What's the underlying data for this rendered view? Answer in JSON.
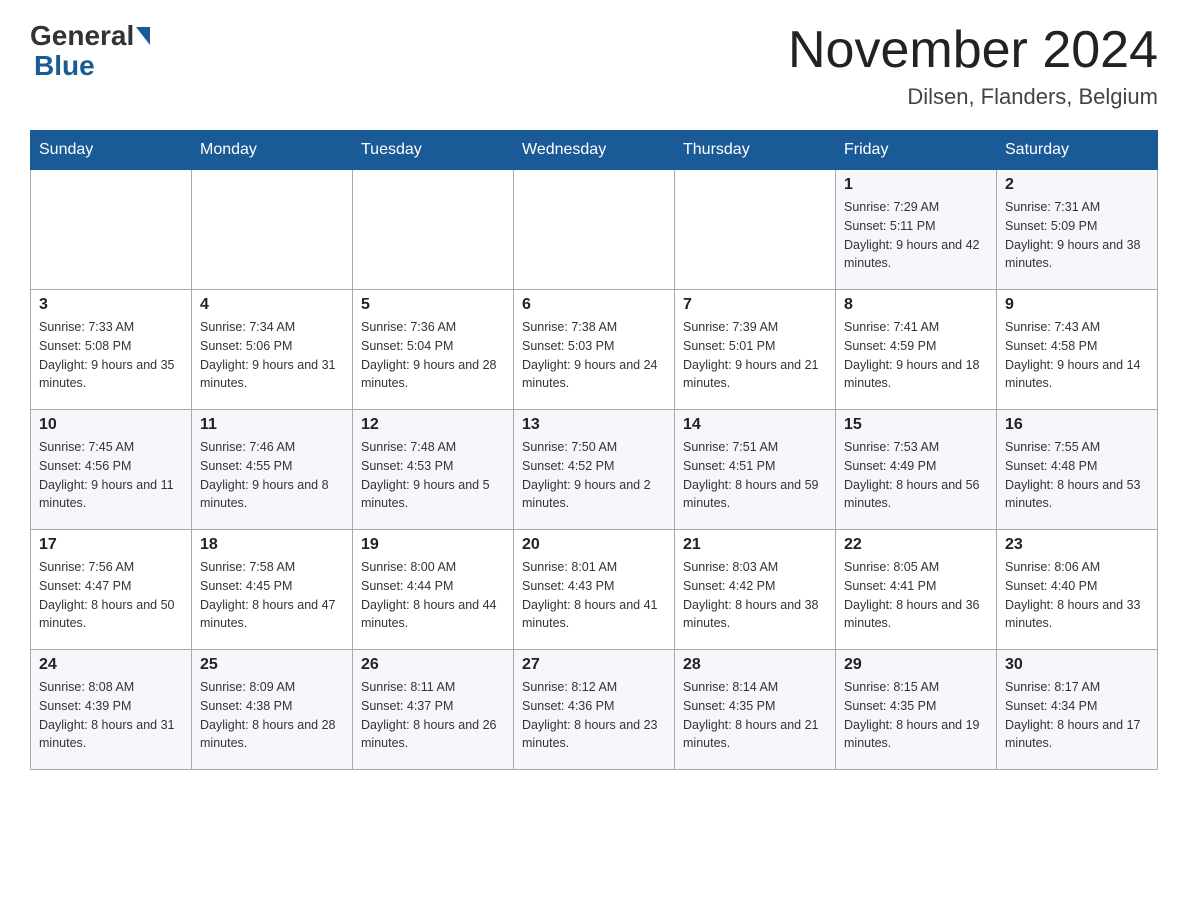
{
  "header": {
    "logo_general": "General",
    "logo_blue": "Blue",
    "month_title": "November 2024",
    "location": "Dilsen, Flanders, Belgium"
  },
  "days_of_week": [
    "Sunday",
    "Monday",
    "Tuesday",
    "Wednesday",
    "Thursday",
    "Friday",
    "Saturday"
  ],
  "weeks": [
    {
      "days": [
        {
          "number": "",
          "info": ""
        },
        {
          "number": "",
          "info": ""
        },
        {
          "number": "",
          "info": ""
        },
        {
          "number": "",
          "info": ""
        },
        {
          "number": "",
          "info": ""
        },
        {
          "number": "1",
          "info": "Sunrise: 7:29 AM\nSunset: 5:11 PM\nDaylight: 9 hours and 42 minutes."
        },
        {
          "number": "2",
          "info": "Sunrise: 7:31 AM\nSunset: 5:09 PM\nDaylight: 9 hours and 38 minutes."
        }
      ]
    },
    {
      "days": [
        {
          "number": "3",
          "info": "Sunrise: 7:33 AM\nSunset: 5:08 PM\nDaylight: 9 hours and 35 minutes."
        },
        {
          "number": "4",
          "info": "Sunrise: 7:34 AM\nSunset: 5:06 PM\nDaylight: 9 hours and 31 minutes."
        },
        {
          "number": "5",
          "info": "Sunrise: 7:36 AM\nSunset: 5:04 PM\nDaylight: 9 hours and 28 minutes."
        },
        {
          "number": "6",
          "info": "Sunrise: 7:38 AM\nSunset: 5:03 PM\nDaylight: 9 hours and 24 minutes."
        },
        {
          "number": "7",
          "info": "Sunrise: 7:39 AM\nSunset: 5:01 PM\nDaylight: 9 hours and 21 minutes."
        },
        {
          "number": "8",
          "info": "Sunrise: 7:41 AM\nSunset: 4:59 PM\nDaylight: 9 hours and 18 minutes."
        },
        {
          "number": "9",
          "info": "Sunrise: 7:43 AM\nSunset: 4:58 PM\nDaylight: 9 hours and 14 minutes."
        }
      ]
    },
    {
      "days": [
        {
          "number": "10",
          "info": "Sunrise: 7:45 AM\nSunset: 4:56 PM\nDaylight: 9 hours and 11 minutes."
        },
        {
          "number": "11",
          "info": "Sunrise: 7:46 AM\nSunset: 4:55 PM\nDaylight: 9 hours and 8 minutes."
        },
        {
          "number": "12",
          "info": "Sunrise: 7:48 AM\nSunset: 4:53 PM\nDaylight: 9 hours and 5 minutes."
        },
        {
          "number": "13",
          "info": "Sunrise: 7:50 AM\nSunset: 4:52 PM\nDaylight: 9 hours and 2 minutes."
        },
        {
          "number": "14",
          "info": "Sunrise: 7:51 AM\nSunset: 4:51 PM\nDaylight: 8 hours and 59 minutes."
        },
        {
          "number": "15",
          "info": "Sunrise: 7:53 AM\nSunset: 4:49 PM\nDaylight: 8 hours and 56 minutes."
        },
        {
          "number": "16",
          "info": "Sunrise: 7:55 AM\nSunset: 4:48 PM\nDaylight: 8 hours and 53 minutes."
        }
      ]
    },
    {
      "days": [
        {
          "number": "17",
          "info": "Sunrise: 7:56 AM\nSunset: 4:47 PM\nDaylight: 8 hours and 50 minutes."
        },
        {
          "number": "18",
          "info": "Sunrise: 7:58 AM\nSunset: 4:45 PM\nDaylight: 8 hours and 47 minutes."
        },
        {
          "number": "19",
          "info": "Sunrise: 8:00 AM\nSunset: 4:44 PM\nDaylight: 8 hours and 44 minutes."
        },
        {
          "number": "20",
          "info": "Sunrise: 8:01 AM\nSunset: 4:43 PM\nDaylight: 8 hours and 41 minutes."
        },
        {
          "number": "21",
          "info": "Sunrise: 8:03 AM\nSunset: 4:42 PM\nDaylight: 8 hours and 38 minutes."
        },
        {
          "number": "22",
          "info": "Sunrise: 8:05 AM\nSunset: 4:41 PM\nDaylight: 8 hours and 36 minutes."
        },
        {
          "number": "23",
          "info": "Sunrise: 8:06 AM\nSunset: 4:40 PM\nDaylight: 8 hours and 33 minutes."
        }
      ]
    },
    {
      "days": [
        {
          "number": "24",
          "info": "Sunrise: 8:08 AM\nSunset: 4:39 PM\nDaylight: 8 hours and 31 minutes."
        },
        {
          "number": "25",
          "info": "Sunrise: 8:09 AM\nSunset: 4:38 PM\nDaylight: 8 hours and 28 minutes."
        },
        {
          "number": "26",
          "info": "Sunrise: 8:11 AM\nSunset: 4:37 PM\nDaylight: 8 hours and 26 minutes."
        },
        {
          "number": "27",
          "info": "Sunrise: 8:12 AM\nSunset: 4:36 PM\nDaylight: 8 hours and 23 minutes."
        },
        {
          "number": "28",
          "info": "Sunrise: 8:14 AM\nSunset: 4:35 PM\nDaylight: 8 hours and 21 minutes."
        },
        {
          "number": "29",
          "info": "Sunrise: 8:15 AM\nSunset: 4:35 PM\nDaylight: 8 hours and 19 minutes."
        },
        {
          "number": "30",
          "info": "Sunrise: 8:17 AM\nSunset: 4:34 PM\nDaylight: 8 hours and 17 minutes."
        }
      ]
    }
  ]
}
